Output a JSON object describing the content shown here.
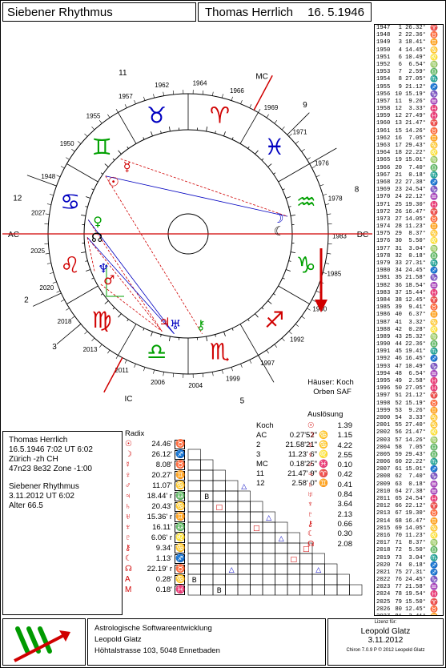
{
  "header": {
    "title": "Siebener Rhythmus",
    "name": "Thomas Herrlich",
    "date": "16. 5.1946"
  },
  "chart": {
    "year_labels": [
      "1962",
      "1964",
      "1966",
      "1969",
      "1971",
      "1976",
      "1978",
      "1983",
      "1985",
      "1990",
      "1992",
      "1997",
      "1999",
      "2004",
      "2006",
      "2011",
      "2013",
      "2018",
      "2020",
      "2025",
      "2027",
      "1948",
      "1950",
      "1955",
      "1957"
    ],
    "house_numbers": [
      "11",
      "MC",
      "9",
      "8",
      "DC",
      "5",
      "IC",
      "3",
      "2",
      "12",
      "AC"
    ],
    "houses_label": "Häuser: Koch",
    "orbs_label": "Orben SAF"
  },
  "years": [
    [
      "1947",
      "1",
      "26.32",
      "♈"
    ],
    [
      "1948",
      "2",
      "22.36",
      "♉"
    ],
    [
      "1949",
      "3",
      "18.41",
      "♊"
    ],
    [
      "1950",
      "4",
      "14.45",
      "♋"
    ],
    [
      "1951",
      "6",
      "10.49",
      "♌"
    ],
    [
      "1952",
      "6",
      "6.54",
      "♍"
    ],
    [
      "1953",
      "7",
      "2.59",
      "♎"
    ],
    [
      "1954",
      "8",
      "27.05",
      "♏"
    ],
    [
      "1955",
      "9",
      "21.12",
      "♐"
    ],
    [
      "1956",
      "10",
      "15.19",
      "♑"
    ],
    [
      "1957",
      "11",
      "9.26",
      "♒"
    ],
    [
      "1958",
      "12",
      "3.33",
      "♓"
    ],
    [
      "1959",
      "12",
      "27.49",
      "♓"
    ],
    [
      "1960",
      "13",
      "21.47",
      "♈"
    ],
    [
      "1961",
      "15",
      "14.26",
      "♉"
    ],
    [
      "1962",
      "16",
      "7.05",
      "♊"
    ],
    [
      "1963",
      "17",
      "29.43",
      "♋"
    ],
    [
      "1964",
      "18",
      "22.22",
      "♌"
    ],
    [
      "1965",
      "19",
      "15.01",
      "♍"
    ],
    [
      "1966",
      "20",
      "7.40",
      "♎"
    ],
    [
      "1967",
      "21",
      "0.18",
      "♏"
    ],
    [
      "1968",
      "22",
      "27.38",
      "♐"
    ],
    [
      "1969",
      "23",
      "24.54",
      "♑"
    ],
    [
      "1970",
      "24",
      "22.12",
      "♒"
    ],
    [
      "1971",
      "25",
      "19.30",
      "♓"
    ],
    [
      "1972",
      "26",
      "16.47",
      "♈"
    ],
    [
      "1973",
      "27",
      "14.05",
      "♉"
    ],
    [
      "1974",
      "28",
      "11.23",
      "♊"
    ],
    [
      "1975",
      "29",
      "8.37",
      "♋"
    ],
    [
      "1976",
      "30",
      "5.50",
      "♌"
    ],
    [
      "1977",
      "31",
      "3.04",
      "♍"
    ],
    [
      "1978",
      "32",
      "0.18",
      "♎"
    ],
    [
      "1979",
      "33",
      "27.31",
      "♏"
    ],
    [
      "1980",
      "34",
      "24.45",
      "♐"
    ],
    [
      "1981",
      "35",
      "21.58",
      "♑"
    ],
    [
      "1982",
      "36",
      "18.54",
      "♒"
    ],
    [
      "1983",
      "37",
      "15.44",
      "♓"
    ],
    [
      "1984",
      "38",
      "12.45",
      "♈"
    ],
    [
      "1985",
      "39",
      "9.41",
      "♉"
    ],
    [
      "1986",
      "40",
      "6.37",
      "♊"
    ],
    [
      "1987",
      "41",
      "3.32",
      "♋"
    ],
    [
      "1988",
      "42",
      "0.28",
      "♌"
    ],
    [
      "1989",
      "43",
      "25.32",
      "♍"
    ],
    [
      "1990",
      "44",
      "22.36",
      "♎"
    ],
    [
      "1991",
      "45",
      "19.41",
      "♏"
    ],
    [
      "1992",
      "46",
      "16.45",
      "♐"
    ],
    [
      "1993",
      "47",
      "10.49",
      "♑"
    ],
    [
      "1994",
      "48",
      "6.54",
      "♒"
    ],
    [
      "1995",
      "49",
      "2.58",
      "♓"
    ],
    [
      "1996",
      "50",
      "27.05",
      "♓"
    ],
    [
      "1997",
      "51",
      "21.12",
      "♈"
    ],
    [
      "1998",
      "52",
      "15.19",
      "♉"
    ],
    [
      "1999",
      "53",
      "9.26",
      "♊"
    ],
    [
      "2000",
      "54",
      "3.33",
      "♋"
    ],
    [
      "2001",
      "55",
      "27.40",
      "♋"
    ],
    [
      "2002",
      "56",
      "21.47",
      "♌"
    ],
    [
      "2003",
      "57",
      "14.26",
      "♍"
    ],
    [
      "2004",
      "58",
      "7.05",
      "♎"
    ],
    [
      "2005",
      "59",
      "29.43",
      "♎"
    ],
    [
      "2006",
      "60",
      "22.22",
      "♏"
    ],
    [
      "2007",
      "61",
      "15.01",
      "♐"
    ],
    [
      "2008",
      "62",
      "7.40",
      "♑"
    ],
    [
      "2009",
      "63",
      "0.18",
      "♒"
    ],
    [
      "2010",
      "64",
      "27.38",
      "♒"
    ],
    [
      "2011",
      "65",
      "24.54",
      "♓"
    ],
    [
      "2012",
      "66",
      "22.12",
      "♈"
    ],
    [
      "2013",
      "67",
      "19.30",
      "♉"
    ],
    [
      "2014",
      "68",
      "16.47",
      "♊"
    ],
    [
      "2015",
      "69",
      "14.05",
      "♋"
    ],
    [
      "2016",
      "70",
      "11.23",
      "♌"
    ],
    [
      "2017",
      "71",
      "8.37",
      "♍"
    ],
    [
      "2018",
      "72",
      "5.50",
      "♎"
    ],
    [
      "2019",
      "73",
      "3.04",
      "♏"
    ],
    [
      "2020",
      "74",
      "0.18",
      "♐"
    ],
    [
      "2021",
      "75",
      "27.31",
      "♐"
    ],
    [
      "2022",
      "76",
      "24.45",
      "♑"
    ],
    [
      "2023",
      "77",
      "21.58",
      "♒"
    ],
    [
      "2024",
      "78",
      "19.54",
      "♓"
    ],
    [
      "2025",
      "79",
      "15.50",
      "♈"
    ],
    [
      "2026",
      "80",
      "12.45",
      "♉"
    ],
    [
      "2027",
      "81",
      "3.41",
      "♊"
    ],
    [
      "2028",
      "82",
      "6.37",
      "♋"
    ],
    [
      "2029",
      "83",
      "3.32",
      "♌"
    ],
    [
      "2030",
      "84",
      "0.28",
      "♍"
    ]
  ],
  "info": {
    "name": "Thomas Herrlich",
    "birth": "16.5.1946 7:02 UT 6:02",
    "place": "Zürich -zh CH",
    "coords": "47n23 8e32 Zone -1:00",
    "method": "Siebener Rhythmus",
    "current": "3.11.2012 UT  6:02",
    "age": "Alter 66.5"
  },
  "radix": {
    "title": "Radix",
    "rows": [
      [
        "☉",
        "24.46'",
        "♉"
      ],
      [
        "☽",
        "26.12'",
        "♐"
      ],
      [
        "☿",
        "8.08'",
        "♉"
      ],
      [
        "♀",
        "20.27'",
        "♊"
      ],
      [
        "♂",
        "11.07'",
        "♋"
      ],
      [
        "♃",
        "18.44' r",
        "♎"
      ],
      [
        "♄",
        "20.43'",
        "♋"
      ],
      [
        "♅",
        "15.36' r",
        "♊"
      ],
      [
        "♆",
        "16.11'",
        "♎"
      ],
      [
        "♇",
        "6.06' r",
        "♌"
      ],
      [
        "⚷",
        "9.34'",
        "♋"
      ],
      [
        "☾",
        "1.13'",
        "♐"
      ],
      [
        "☊",
        "22.19' r",
        "♉"
      ],
      [
        "A",
        "0.28'",
        "♋"
      ],
      [
        "M",
        "0.18'",
        "♓"
      ]
    ]
  },
  "koch": {
    "title": "Koch",
    "rows": [
      [
        "AC",
        "0.27'52\"",
        "♋"
      ],
      [
        "2",
        "21.58'21\"",
        "♋"
      ],
      [
        "3",
        "11.23' 6\"",
        "♌"
      ],
      [
        "MC",
        "0.18'25\"",
        "♓"
      ],
      [
        "11",
        "21.47' 9\"",
        "♈"
      ],
      [
        "12",
        "2.58' 0\"",
        "♊"
      ]
    ]
  },
  "aus": {
    "title": "Auslösung",
    "rows": [
      [
        "☉",
        "1.39"
      ],
      [
        "☽",
        "1.15"
      ],
      [
        "☿",
        "4.22"
      ],
      [
        "♀",
        "2.55"
      ],
      [
        "♂",
        "0.10"
      ],
      [
        "♃",
        "0.42"
      ],
      [
        "♄",
        "0.41"
      ],
      [
        "♅",
        "0.84"
      ],
      [
        "♆",
        "3.64"
      ],
      [
        "♇",
        "2.13"
      ],
      [
        "⚷",
        "0.66"
      ],
      [
        "☾",
        "0.30"
      ],
      [
        "☊",
        "2.08"
      ]
    ]
  },
  "footer": {
    "line1": "Astrologische Softwareentwicklung",
    "line2": "Leopold Glatz",
    "line3": "Höhtalstrasse 103, 5048 Ennetbaden",
    "lic_label": "Lizenz für:",
    "lic_name": "Leopold Glatz",
    "lic_date": "3.11.2012",
    "version": "Chiron 7.0.9 P © 2012 Leopold Glatz"
  },
  "colors": {
    "red": "#d00000",
    "green": "#00a000",
    "blue": "#0000c0"
  }
}
